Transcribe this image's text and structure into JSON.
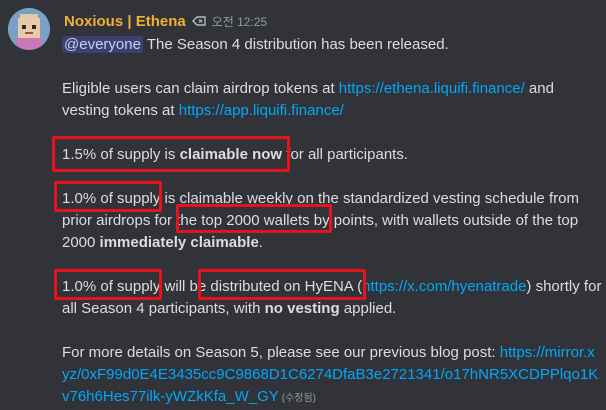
{
  "author": {
    "name": "Noxious | Ethena",
    "timestamp": "오전 12:25"
  },
  "icons": {
    "avatar": "pixel-avatar-icon",
    "tag": "tag-icon"
  },
  "colors": {
    "author": "#f0b232",
    "link": "#00a8fc",
    "highlight": "#e8121c",
    "background": "#313338"
  },
  "message": {
    "mention": "@everyone",
    "line1": " The Season 4 distribution has been released.",
    "p2_text1": "Eligible users can claim airdrop tokens at ",
    "p2_link1": "https://ethena.liquifi.finance/",
    "p2_text2": " and vesting tokens at ",
    "p2_link2": "https://app.liquifi.finance/",
    "p3_text1": "1.5% of supply is ",
    "p3_bold": "claimable now",
    "p3_text2": " for all participants.",
    "p4_text1": "1.0% of supply is claimable weekly on the standardized vesting schedule from prior airdrops for the top 2000 wallets by points, with wallets outside of the top 2000 ",
    "p4_bold": "immediately claimable",
    "p4_text2": ".",
    "p5_text1": "1.0% of supply will be distributed on HyENA (",
    "p5_link": "https://x.com/hyenatrade",
    "p5_text2": ") shortly for all Season 4 participants, with ",
    "p5_bold": "no vesting",
    "p5_text3": " applied.",
    "p6_text1": "For more details on Season 5, please see our previous blog post: ",
    "p6_link": "https://mirror.xyz/0xF99d0E4E3435cc9C9868D1C6274DfaB3e2721341/o17hNR5XCDPPlqo1Kv76h6Hes77ilk-yWZkKfa_W_GY",
    "edited": "(수정됨)"
  }
}
